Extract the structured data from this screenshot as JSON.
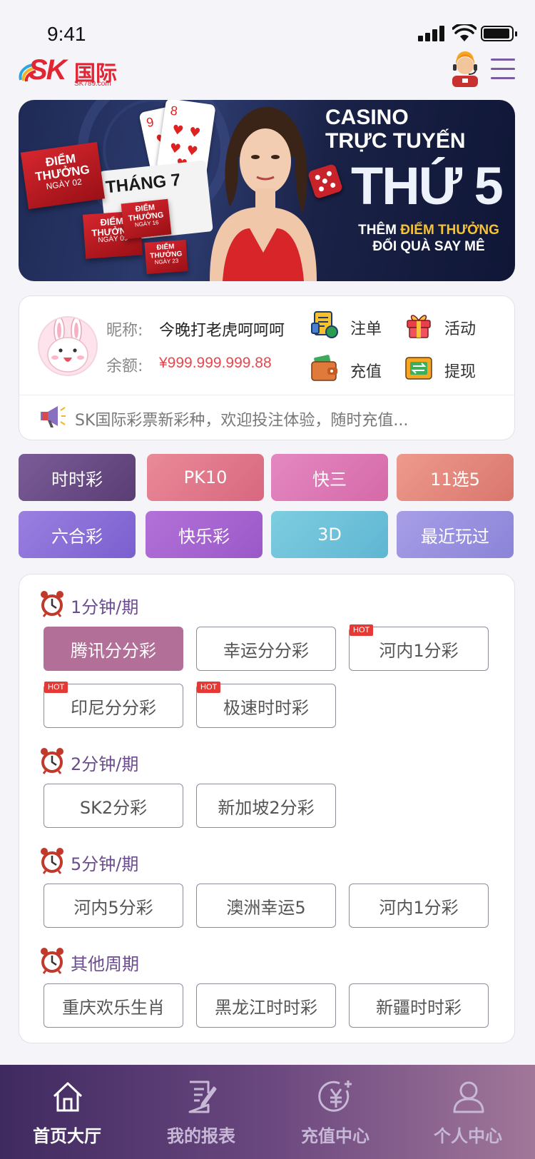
{
  "status_bar": {
    "time": "9:41"
  },
  "header": {
    "logo_text": "SK",
    "logo_cn": "国际",
    "logo_url": "SK789.com"
  },
  "banner": {
    "tiles": [
      {
        "line1": "ĐIỂM",
        "line2": "THƯỞNG",
        "line3": "NGÀY 02"
      },
      {
        "line1": "ĐIỂM",
        "line2": "THƯỞNG",
        "line3": "NGÀY 09"
      },
      {
        "line1": "ĐIỂM",
        "line2": "THƯỞNG",
        "line3": "NGÀY 16"
      },
      {
        "line1": "ĐIỂM",
        "line2": "THƯỞNG",
        "line3": "NGÀY 23"
      }
    ],
    "calendar_title": "THÁNG 7",
    "casino_line1": "CASINO",
    "casino_line2": "TRỰC TUYẾN",
    "headline": "THỨ 5",
    "sub_line1_a": "THÊM ",
    "sub_line1_b": "ĐIỂM THƯỞNG",
    "sub_line2": "ĐỔI QUÀ SAY MÊ"
  },
  "user": {
    "nick_label": "昵称:",
    "nickname": "今晚打老虎呵呵呵",
    "balance_label": "余额:",
    "balance": "¥999.999.999.88"
  },
  "actions": {
    "orders": "注单",
    "activity": "活动",
    "deposit": "充值",
    "withdraw": "提现"
  },
  "notice": "SK国际彩票新彩种，欢迎投注体验，随时充值...",
  "categories": [
    {
      "label": "时时彩",
      "color": "#6d4d8a"
    },
    {
      "label": "PK10",
      "color": "#e07a8f"
    },
    {
      "label": "快三",
      "color": "#e07bb8"
    },
    {
      "label": "11选5",
      "color": "#e68a7d"
    },
    {
      "label": "六合彩",
      "color": "#8a6fd6"
    },
    {
      "label": "快乐彩",
      "color": "#a765d0"
    },
    {
      "label": "3D",
      "color": "#71c1d8"
    },
    {
      "label": "最近玩过",
      "color": "#9a92df"
    }
  ],
  "sections": {
    "s1": {
      "title": "1分钟/期",
      "games": [
        {
          "label": "腾讯分分彩",
          "hot": ""
        },
        {
          "label": "幸运分分彩",
          "hot": ""
        },
        {
          "label": "河内1分彩",
          "hot": "HOT"
        },
        {
          "label": "印尼分分彩",
          "hot": "HOT"
        },
        {
          "label": "极速时时彩",
          "hot": "HOT"
        }
      ]
    },
    "s2": {
      "title": "2分钟/期",
      "games": [
        {
          "label": "SK2分彩",
          "hot": ""
        },
        {
          "label": "新加坡2分彩",
          "hot": ""
        }
      ]
    },
    "s3": {
      "title": "5分钟/期",
      "games": [
        {
          "label": "河内5分彩",
          "hot": ""
        },
        {
          "label": "澳洲幸运5",
          "hot": ""
        },
        {
          "label": "河内1分彩",
          "hot": ""
        }
      ]
    },
    "s4": {
      "title": "其他周期",
      "games": [
        {
          "label": "重庆欢乐生肖",
          "hot": ""
        },
        {
          "label": "黑龙江时时彩",
          "hot": ""
        },
        {
          "label": "新疆时时彩",
          "hot": ""
        }
      ]
    }
  },
  "nav": {
    "home": "首页大厅",
    "reports": "我的报表",
    "recharge": "充值中心",
    "profile": "个人中心"
  }
}
